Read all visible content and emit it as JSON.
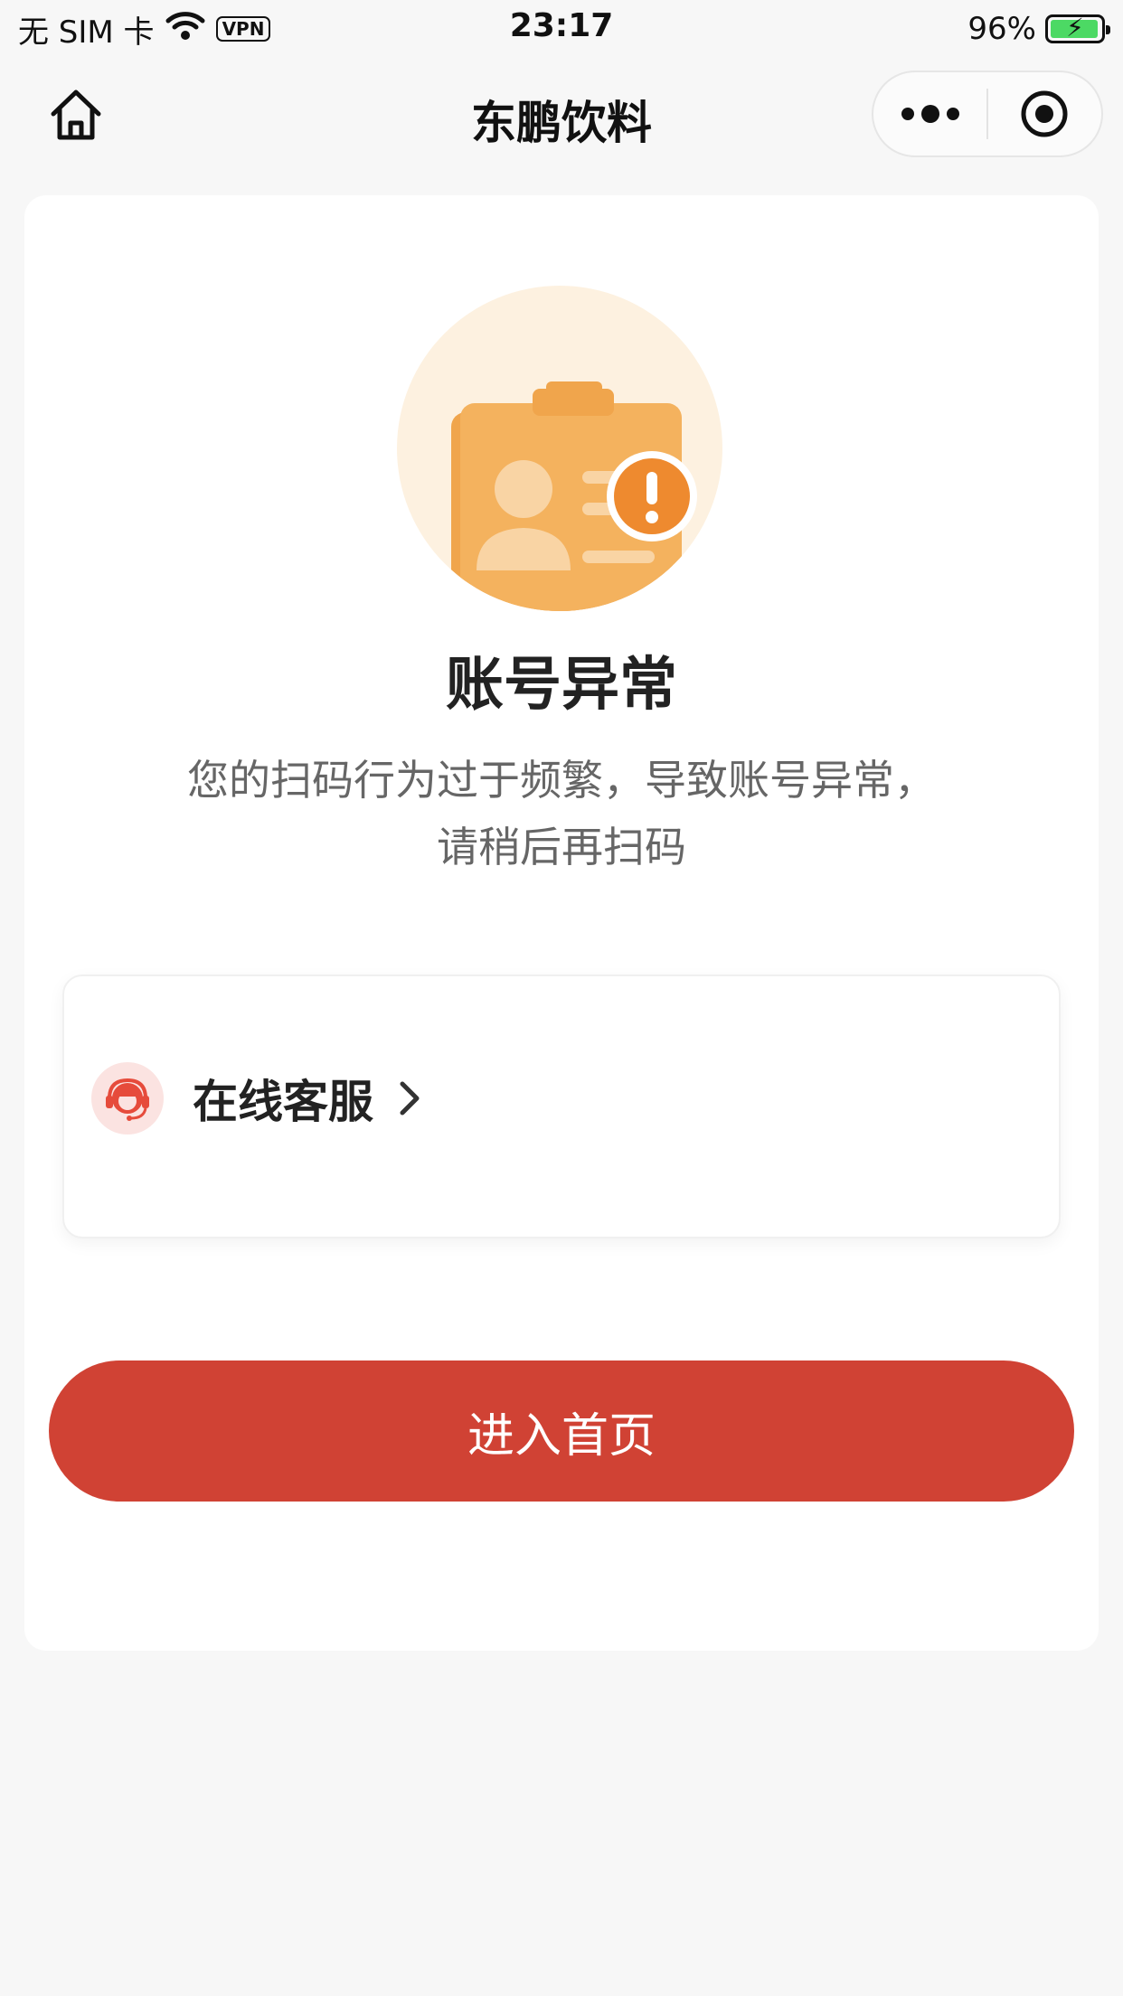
{
  "status_bar": {
    "carrier": "无 SIM 卡",
    "vpn": "VPN",
    "time": "23:17",
    "battery_text": "96%",
    "battery_level": 0.96,
    "battery_color": "#4cd964"
  },
  "nav": {
    "title": "东鹏饮料",
    "home_icon": "home-icon",
    "more_icon": "more-dots-icon",
    "close_icon": "target-close-icon"
  },
  "content": {
    "heading": "账号异常",
    "message_line1": "您的扫码行为过于频繁，导致账号异常，",
    "message_line2": "请稍后再扫码",
    "illustration_icon": "id-card-warning-icon"
  },
  "service": {
    "label": "在线客服",
    "icon": "customer-service-icon",
    "arrow_icon": "chevron-right-icon"
  },
  "primary_button": {
    "label": "进入首页",
    "color": "#d04234"
  }
}
